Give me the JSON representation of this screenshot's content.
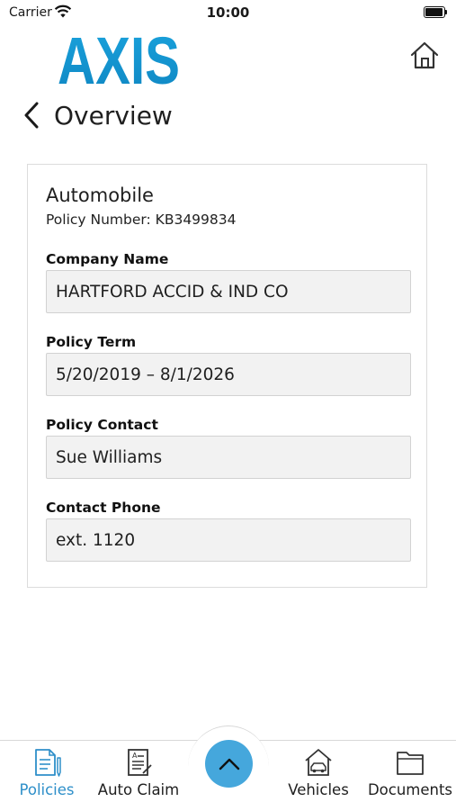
{
  "status_bar": {
    "carrier": "Carrier",
    "time": "10:00"
  },
  "header": {
    "logo_text": "AXIS",
    "brand_color": "#1599d4",
    "home_icon": "home-icon"
  },
  "nav": {
    "back_icon": "chevron-left-icon",
    "title": "Overview"
  },
  "card": {
    "title": "Automobile",
    "policy_number": "Policy Number: KB3499834",
    "fields": [
      {
        "label": "Company Name",
        "value": "HARTFORD ACCID & IND CO"
      },
      {
        "label": "Policy Term",
        "value": "5/20/2019 – 8/1/2026"
      },
      {
        "label": "Policy Contact",
        "value": "Sue Williams"
      },
      {
        "label": "Contact Phone",
        "value": "ext. 1120"
      }
    ]
  },
  "tab_bar": {
    "accent": "#45a7dc",
    "active_color": "#2e8fc9",
    "tabs": [
      {
        "label": "Policies",
        "icon": "policies-icon",
        "active": true
      },
      {
        "label": "Auto Claim",
        "icon": "auto-claim-icon",
        "active": false
      },
      {
        "label": "Vehicles",
        "icon": "vehicles-icon",
        "active": false
      },
      {
        "label": "Documents",
        "icon": "documents-icon",
        "active": false
      }
    ],
    "center_button_icon": "chevron-up-icon"
  }
}
